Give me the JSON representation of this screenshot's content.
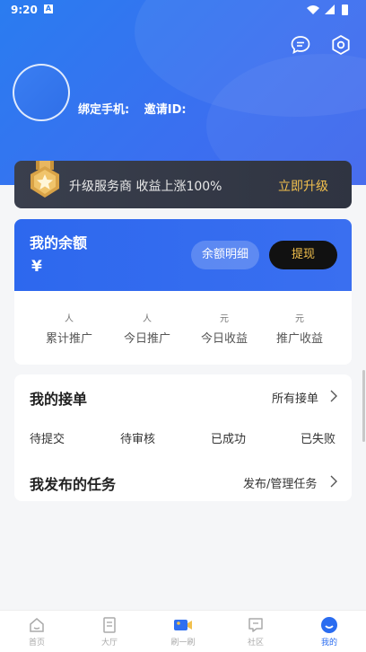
{
  "status_bar": {
    "time": "9:20",
    "notification_glyph": "A"
  },
  "header": {
    "icons": [
      "chat-icon",
      "settings-icon"
    ],
    "phone_label": "绑定手机:",
    "invite_label": "邀请ID:"
  },
  "upgrade": {
    "text": "升级服务商 收益上涨100%",
    "button": "立即升级"
  },
  "balance": {
    "title": "我的余额",
    "amount": "¥",
    "detail_button": "余额明细",
    "withdraw_button": "提现"
  },
  "stats": [
    {
      "unit": "人",
      "label": "累计推广"
    },
    {
      "unit": "人",
      "label": "今日推广"
    },
    {
      "unit": "元",
      "label": "今日收益"
    },
    {
      "unit": "元",
      "label": "推广收益"
    }
  ],
  "orders": {
    "title": "我的接单",
    "all_link": "所有接单",
    "statuses": [
      "待提交",
      "待审核",
      "已成功",
      "已失败"
    ]
  },
  "tasks": {
    "title": "我发布的任务",
    "manage_link": "发布/管理任务"
  },
  "tabbar": [
    {
      "label": "首页",
      "icon": "home-icon"
    },
    {
      "label": "大厅",
      "icon": "hall-icon"
    },
    {
      "label": "刷一刷",
      "icon": "video-icon"
    },
    {
      "label": "社区",
      "icon": "community-icon"
    },
    {
      "label": "我的",
      "icon": "profile-icon",
      "active": true
    }
  ],
  "colors": {
    "accent": "#2a6cf0",
    "gold": "#f2c04d",
    "dark": "#2f3441"
  }
}
